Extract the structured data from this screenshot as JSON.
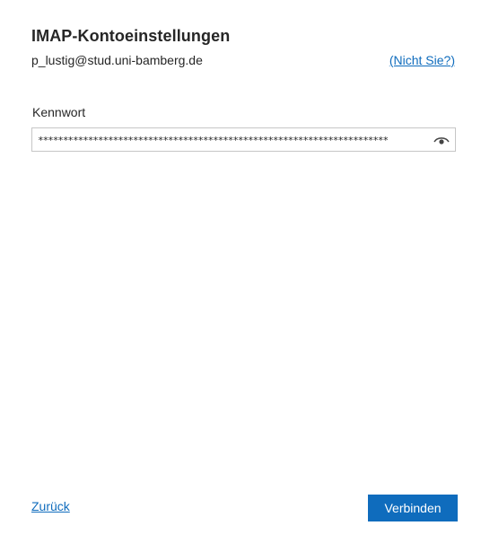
{
  "dialog": {
    "title": "IMAP-Kontoeinstellungen",
    "email": "p_lustig@stud.uni-bamberg.de",
    "not_you_link": "(Nicht Sie?)"
  },
  "password": {
    "label": "Kennwort",
    "masked_value": "**********************************************************************",
    "reveal_icon": "eye-icon"
  },
  "footer": {
    "back_label": "Zurück",
    "connect_label": "Verbinden"
  },
  "colors": {
    "accent": "#0f6cbd",
    "text": "#262626",
    "border": "#c6c6c6"
  }
}
